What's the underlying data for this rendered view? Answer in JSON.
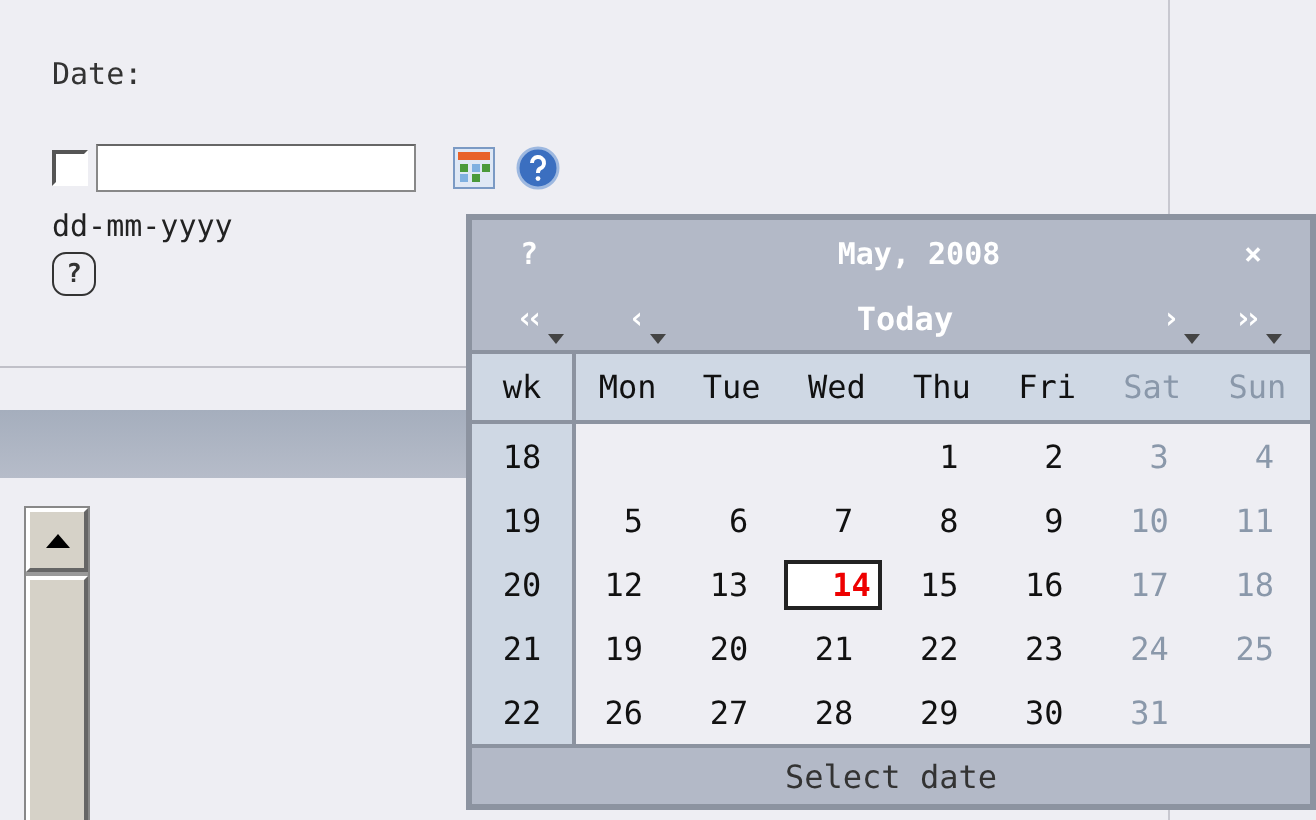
{
  "form": {
    "label": "Date:",
    "checkbox": {
      "checked": false
    },
    "format_hint": "dd-mm-yyyy",
    "help_mark": "?"
  },
  "calendar": {
    "help": "?",
    "title": "May, 2008",
    "close": "×",
    "nav": [
      {
        "kind": "arrow",
        "label": "‹‹"
      },
      {
        "kind": "arrow",
        "label": "‹"
      },
      {
        "kind": "today",
        "label": "Today"
      },
      {
        "kind": "arrow",
        "label": "›"
      },
      {
        "kind": "arrow",
        "label": "››"
      }
    ],
    "week_header": "wk",
    "day_headers": [
      {
        "label": "Mon",
        "weekend": false
      },
      {
        "label": "Tue",
        "weekend": false
      },
      {
        "label": "Wed",
        "weekend": false
      },
      {
        "label": "Thu",
        "weekend": false
      },
      {
        "label": "Fri",
        "weekend": false
      },
      {
        "label": "Sat",
        "weekend": true
      },
      {
        "label": "Sun",
        "weekend": true
      }
    ],
    "weeks": [
      {
        "number": "18",
        "days": [
          {
            "text": "1",
            "selected": false
          },
          {
            "text": "2",
            "selected": false
          },
          {
            "text": "3",
            "selected": false
          },
          {
            "text": "4",
            "selected": false
          }
        ]
      },
      {
        "number": "19",
        "days": [
          {
            "text": "5",
            "selected": false
          },
          {
            "text": "6",
            "selected": false
          },
          {
            "text": "7",
            "selected": false
          },
          {
            "text": "8",
            "selected": false
          },
          {
            "text": "9",
            "selected": false
          },
          {
            "text": "10",
            "selected": false
          },
          {
            "text": "11",
            "selected": false
          }
        ]
      },
      {
        "number": "20",
        "days": [
          {
            "text": "12",
            "selected": false
          },
          {
            "text": "13",
            "selected": false
          },
          {
            "text": "14",
            "selected": true
          },
          {
            "text": "15",
            "selected": false
          },
          {
            "text": "16",
            "selected": false
          },
          {
            "text": "17",
            "selected": false
          },
          {
            "text": "18",
            "selected": false
          }
        ]
      },
      {
        "number": "21",
        "days": [
          {
            "text": "19",
            "selected": false
          },
          {
            "text": "20",
            "selected": false
          },
          {
            "text": "21",
            "selected": false
          },
          {
            "text": "22",
            "selected": false
          },
          {
            "text": "23",
            "selected": false
          },
          {
            "text": "24",
            "selected": false
          },
          {
            "text": "25",
            "selected": false
          }
        ]
      },
      {
        "number": "22",
        "days": [
          {
            "text": "26",
            "selected": false
          },
          {
            "text": "27",
            "selected": false
          },
          {
            "text": "28",
            "selected": false
          },
          {
            "text": "29",
            "selected": false
          },
          {
            "text": "30",
            "selected": false
          },
          {
            "text": "31",
            "selected": false
          }
        ]
      }
    ],
    "footer": "Select date"
  }
}
